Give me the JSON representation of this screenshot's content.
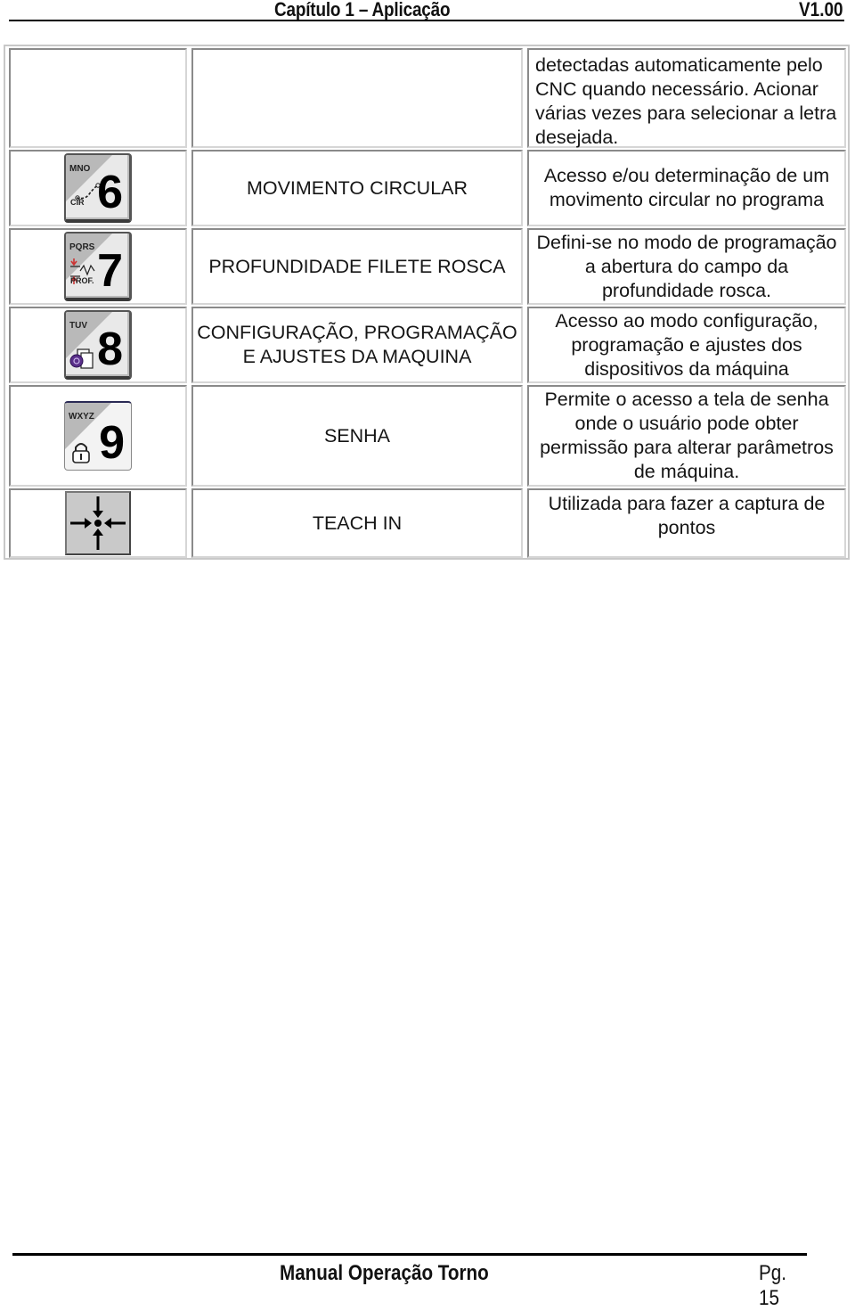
{
  "header": {
    "chapter_title": "Capítulo 1 – Aplicação",
    "version": "V1.00"
  },
  "table": {
    "rows": [
      {
        "icon": null,
        "name": "",
        "description": "detectadas automaticamente pelo CNC quando necessário. Acionar várias vezes para selecionar a letra desejada."
      },
      {
        "icon": {
          "semantic": "key-6-circular-icon",
          "letters": "MNO",
          "digit": "6",
          "sub": "CIR"
        },
        "name": "MOVIMENTO CIRCULAR",
        "description": "Acesso e/ou determinação de um movimento circular no programa"
      },
      {
        "icon": {
          "semantic": "key-7-thread-depth-icon",
          "letters": "PQRS",
          "digit": "7",
          "sub": "PROF."
        },
        "name": "PROFUNDIDADE FILETE ROSCA",
        "description": "Defini-se no modo de programação a abertura do campo da profundidade rosca."
      },
      {
        "icon": {
          "semantic": "key-8-config-icon",
          "letters": "TUV",
          "digit": "8",
          "sub": ""
        },
        "name": "CONFIGURAÇÃO, PROGRAMAÇÃO E AJUSTES DA MAQUINA",
        "description": "Acesso ao modo configuração, programação e ajustes dos dispositivos da máquina"
      },
      {
        "icon": {
          "semantic": "key-9-password-lock-icon",
          "letters": "WXYZ",
          "digit": "9",
          "sub": ""
        },
        "name": "SENHA",
        "description": "Permite o acesso a tela de senha onde o usuário pode obter permissão para alterar parâmetros de máquina."
      },
      {
        "icon": {
          "semantic": "teach-in-arrows-icon"
        },
        "name": "TEACH IN",
        "description": "Utilizada para fazer a captura de pontos"
      }
    ]
  },
  "footer": {
    "manual_title": "Manual Operação Torno",
    "page_label": "Pg. 15"
  }
}
